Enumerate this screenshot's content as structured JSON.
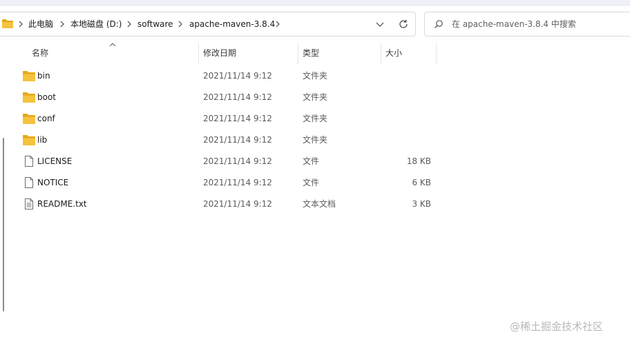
{
  "address": {
    "breadcrumbs": [
      "此电脑",
      "本地磁盘 (D:)",
      "software",
      "apache-maven-3.8.4"
    ]
  },
  "search": {
    "placeholder": "在 apache-maven-3.8.4 中搜索"
  },
  "columns": {
    "name": "名称",
    "date": "修改日期",
    "type": "类型",
    "size": "大小"
  },
  "files": [
    {
      "name": "bin",
      "date": "2021/11/14 9:12",
      "type": "文件夹",
      "size": "",
      "icon": "folder-icon"
    },
    {
      "name": "boot",
      "date": "2021/11/14 9:12",
      "type": "文件夹",
      "size": "",
      "icon": "folder-icon"
    },
    {
      "name": "conf",
      "date": "2021/11/14 9:12",
      "type": "文件夹",
      "size": "",
      "icon": "folder-icon"
    },
    {
      "name": "lib",
      "date": "2021/11/14 9:12",
      "type": "文件夹",
      "size": "",
      "icon": "folder-icon"
    },
    {
      "name": "LICENSE",
      "date": "2021/11/14 9:12",
      "type": "文件",
      "size": "18 KB",
      "icon": "file-icon"
    },
    {
      "name": "NOTICE",
      "date": "2021/11/14 9:12",
      "type": "文件",
      "size": "6 KB",
      "icon": "file-icon"
    },
    {
      "name": "README.txt",
      "date": "2021/11/14 9:12",
      "type": "文本文档",
      "size": "3 KB",
      "icon": "text-file-icon"
    }
  ],
  "watermark": "@稀土掘金技术社区",
  "colors": {
    "folder": "#f4c33f",
    "folder_dark": "#e6a817",
    "border": "#d6d9de"
  }
}
